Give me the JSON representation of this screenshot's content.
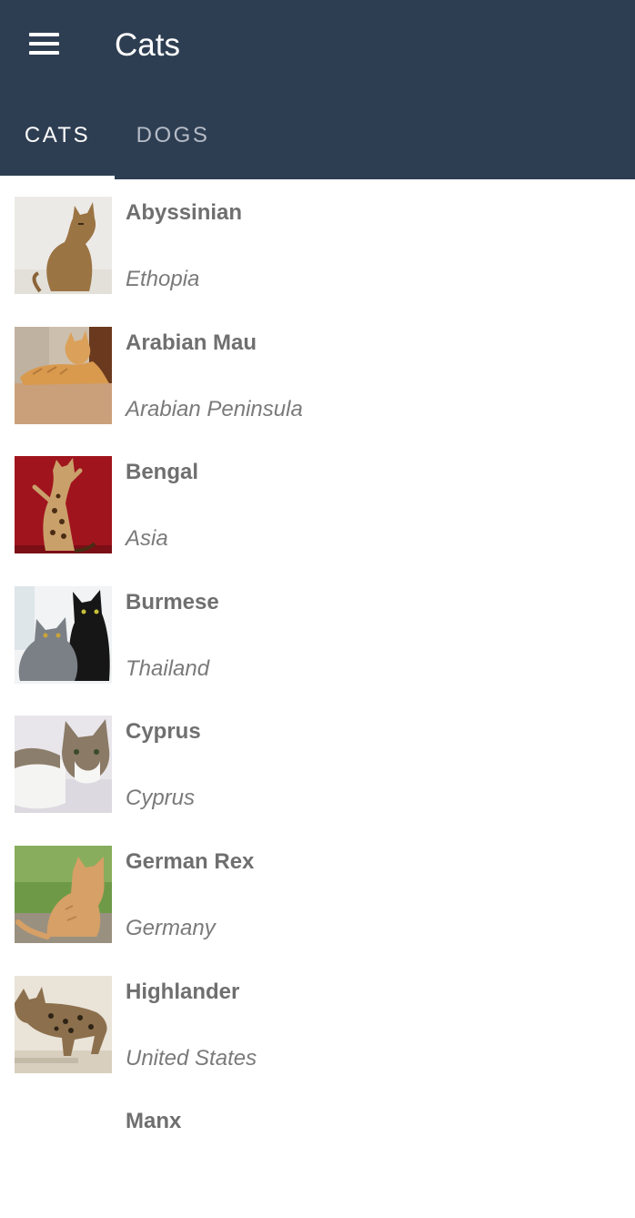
{
  "app": {
    "title": "Cats",
    "menu_icon": "menu-icon"
  },
  "tabs": [
    {
      "label": "CATS",
      "selected": true
    },
    {
      "label": "DOGS",
      "selected": false
    }
  ],
  "colors": {
    "app_bar": "#2e3e52",
    "tab_selected": "#ffffff",
    "tab_unselected": "#b6bcc7",
    "name_text": "#6f6f6f",
    "origin_text": "#7a7a7a"
  },
  "breeds": [
    {
      "name": "Abyssinian",
      "origin": "Ethopia"
    },
    {
      "name": "Arabian Mau",
      "origin": "Arabian Peninsula"
    },
    {
      "name": "Bengal",
      "origin": "Asia"
    },
    {
      "name": "Burmese",
      "origin": "Thailand"
    },
    {
      "name": "Cyprus",
      "origin": "Cyprus"
    },
    {
      "name": "German Rex",
      "origin": "Germany"
    },
    {
      "name": "Highlander",
      "origin": "United States"
    },
    {
      "name": "Manx",
      "origin": ""
    }
  ]
}
